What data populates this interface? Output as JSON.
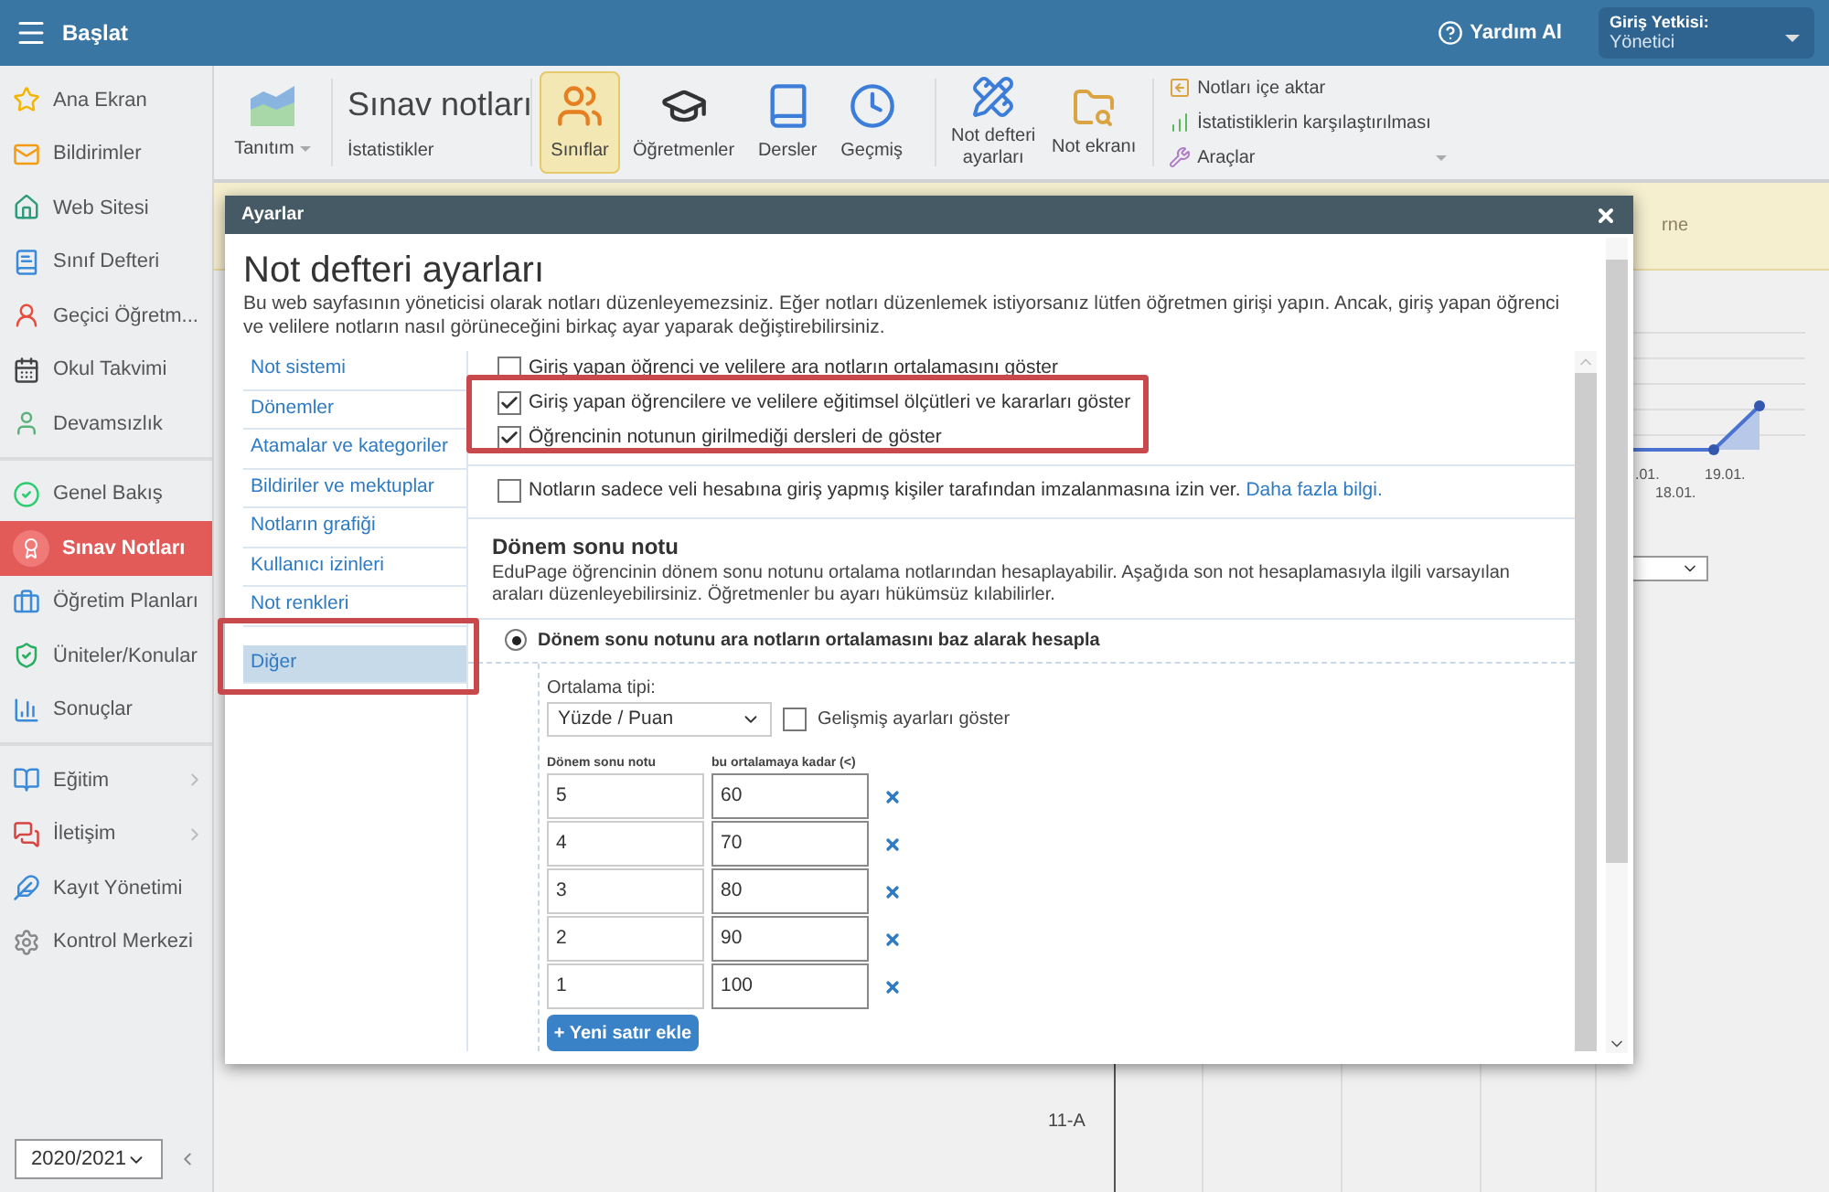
{
  "top_bar": {
    "title": "Başlat",
    "help": "Yardım Al",
    "role_label": "Giriş Yetkisi:",
    "role_value": "Yönetici"
  },
  "sidebar": {
    "groups": [
      [
        {
          "label": "Ana Ekran",
          "selected": false,
          "submenu": false
        },
        {
          "label": "Bildirimler",
          "selected": false,
          "submenu": false
        },
        {
          "label": "Web Sitesi",
          "selected": false,
          "submenu": false
        },
        {
          "label": "Sınıf Defteri",
          "selected": false,
          "submenu": false
        },
        {
          "label": "Geçici Öğretm...",
          "selected": false,
          "submenu": false
        },
        {
          "label": "Okul Takvimi",
          "selected": false,
          "submenu": false
        },
        {
          "label": "Devamsızlık",
          "selected": false,
          "submenu": false
        }
      ],
      [
        {
          "label": "Genel Bakış",
          "selected": false,
          "submenu": false
        },
        {
          "label": "Sınav Notları",
          "selected": true,
          "submenu": false
        },
        {
          "label": "Öğretim Planları",
          "selected": false,
          "submenu": false
        },
        {
          "label": "Üniteler/Konular",
          "selected": false,
          "submenu": false
        },
        {
          "label": "Sonuçlar",
          "selected": false,
          "submenu": false
        }
      ],
      [
        {
          "label": "Eğitim",
          "selected": false,
          "submenu": true
        },
        {
          "label": "İletişim",
          "selected": false,
          "submenu": true
        },
        {
          "label": "Kayıt Yönetimi",
          "selected": false,
          "submenu": false
        },
        {
          "label": "Kontrol Merkezi",
          "selected": false,
          "submenu": false
        }
      ]
    ],
    "year": "2020/2021"
  },
  "toolbar": {
    "intro": "Tanıtım",
    "title": "Sınav notları",
    "subtitle": "İstatistikler",
    "views": [
      {
        "label": "Sınıflar",
        "selected": true
      },
      {
        "label": "Öğretmenler",
        "selected": false
      },
      {
        "label": "Dersler",
        "selected": false
      },
      {
        "label": "Geçmiş",
        "selected": false
      }
    ],
    "actions": [
      "Not defteri ayarları",
      "Not ekranı"
    ],
    "links": [
      {
        "label": "Notları içe aktar",
        "dropdown": false
      },
      {
        "label": "İstatistiklerin karşılaştırılması",
        "dropdown": false
      },
      {
        "label": "Araçlar",
        "dropdown": true
      }
    ]
  },
  "background": {
    "column_header": "rne",
    "chart_labels": [
      ".01.",
      "18.01.",
      "19.01."
    ],
    "row_label": "11-A"
  },
  "dialog": {
    "title": "Ayarlar",
    "heading": "Not defteri ayarları",
    "description": "Bu web sayfasının yöneticisi olarak notları düzenleyemezsiniz. Eğer notları düzenlemek istiyorsanız lütfen öğretmen girişi yapın. Ancak, giriş yapan öğrenci ve velilere notların nasıl görüneceğini birkaç ayar yaparak değiştirebilirsiniz.",
    "nav": [
      {
        "label": "Not sistemi",
        "selected": false
      },
      {
        "label": "Dönemler",
        "selected": false
      },
      {
        "label": "Atamalar ve kategoriler",
        "selected": false
      },
      {
        "label": "Bildiriler ve mektuplar",
        "selected": false
      },
      {
        "label": "Notların grafiği",
        "selected": false
      },
      {
        "label": "Kullanıcı izinleri",
        "selected": false
      },
      {
        "label": "Not renkleri",
        "selected": false
      },
      {
        "label": "Diğer",
        "selected": true
      }
    ],
    "options": [
      {
        "label": "Giriş yapan öğrenci ve velilere ara notların ortalamasını göster",
        "checked": false
      },
      {
        "label": "Giriş yapan öğrencilere ve velilere eğitimsel ölçütleri ve kararları göster",
        "checked": true
      },
      {
        "label": "Öğrencinin notunun girilmediği dersleri de göster",
        "checked": true
      },
      {
        "label": "Notların sadece veli hesabına giriş yapmış kişiler tarafından imzalanmasına izin ver.",
        "checked": false,
        "link": "Daha fazla bilgi."
      }
    ],
    "section": {
      "title": "Dönem sonu notu",
      "description": "EduPage öğrencinin dönem sonu notunu ortalama notlarından hesaplayabilir. Aşağıda son not hesaplamasıyla ilgili varsayılan araları düzenleyebilirsiniz. Öğretmenler bu ayarı hükümsüz kılabilirler.",
      "radio": {
        "label": "Dönem sonu notunu ara notların ortalamasını baz alarak hesapla",
        "selected": true
      },
      "average_type_label": "Ortalama tipi:",
      "average_type": "Yüzde / Puan",
      "advanced": {
        "label": "Gelişmiş ayarları göster",
        "checked": false
      },
      "columns": [
        "Dönem sonu notu",
        "bu ortalamaya kadar (<)"
      ],
      "rows": [
        {
          "grade": "5",
          "limit": "60"
        },
        {
          "grade": "4",
          "limit": "70"
        },
        {
          "grade": "3",
          "limit": "80"
        },
        {
          "grade": "2",
          "limit": "90"
        },
        {
          "grade": "1",
          "limit": "100"
        }
      ],
      "add_button": "+ Yeni satır ekle"
    }
  }
}
